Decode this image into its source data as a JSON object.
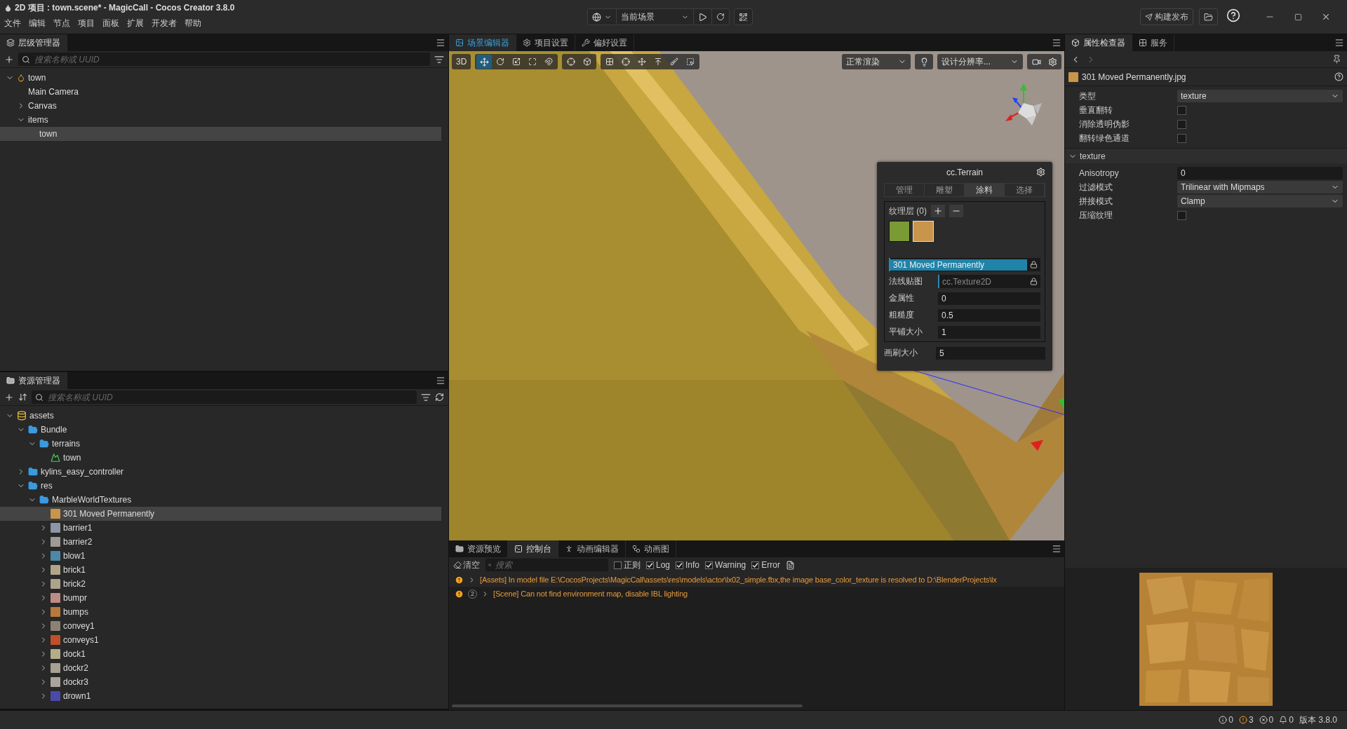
{
  "window": {
    "title": "2D 项目 : town.scene* - MagicCall - Cocos Creator 3.8.0"
  },
  "menu": [
    "文件",
    "编辑",
    "节点",
    "项目",
    "面板",
    "扩展",
    "开发者",
    "帮助"
  ],
  "toolbar": {
    "preview_target": "当前场景",
    "build_button": "构建发布"
  },
  "hierarchy": {
    "tab": "层级管理器",
    "search": {
      "placeholder": "搜索名称或 UUID"
    },
    "tree": [
      {
        "label": "town",
        "kind": "scene",
        "expanded": true,
        "selected": false,
        "children": [
          {
            "label": "Main Camera",
            "selected": false
          },
          {
            "label": "Canvas",
            "expanded": false,
            "selected": false
          },
          {
            "label": "items",
            "expanded": true,
            "selected": false,
            "children": [
              {
                "label": "town",
                "selected": true
              }
            ]
          }
        ]
      }
    ]
  },
  "assets": {
    "tab": "资源管理器",
    "search": {
      "placeholder": "搜索名称或 UUID"
    },
    "tree": [
      {
        "label": "assets",
        "kind": "database",
        "expanded": true,
        "selected": false,
        "children": [
          {
            "label": "Bundle",
            "kind": "folder",
            "expanded": true,
            "selected": false,
            "children": [
              {
                "label": "terrains",
                "kind": "folder",
                "expanded": true,
                "selected": false,
                "children": [
                  {
                    "label": "town",
                    "kind": "terrain",
                    "selected": false
                  }
                ]
              }
            ]
          },
          {
            "label": "kylins_easy_controller",
            "kind": "folder",
            "expanded": false,
            "selected": false
          },
          {
            "label": "res",
            "kind": "folder",
            "expanded": true,
            "selected": false,
            "children": [
              {
                "label": "MarbleWorldTextures",
                "kind": "folder",
                "expanded": true,
                "selected": false,
                "children": [
                  {
                    "label": "301 Moved Permanently",
                    "kind": "texture",
                    "color": "#c8954a",
                    "selected": true
                  },
                  {
                    "label": "barrier1",
                    "kind": "texture",
                    "color": "#8c96a4",
                    "expanded": false,
                    "selected": false
                  },
                  {
                    "label": "barrier2",
                    "kind": "texture",
                    "color": "#a09a94",
                    "expanded": false,
                    "selected": false
                  },
                  {
                    "label": "blow1",
                    "kind": "texture",
                    "color": "#4a8aa8",
                    "expanded": false,
                    "selected": false
                  },
                  {
                    "label": "brick1",
                    "kind": "texture",
                    "color": "#b0a48a",
                    "expanded": false,
                    "selected": false
                  },
                  {
                    "label": "brick2",
                    "kind": "texture",
                    "color": "#ada38c",
                    "expanded": false,
                    "selected": false
                  },
                  {
                    "label": "bumpr",
                    "kind": "texture",
                    "color": "#c08a86",
                    "expanded": false,
                    "selected": false
                  },
                  {
                    "label": "bumps",
                    "kind": "texture",
                    "color": "#b87a3a",
                    "expanded": false,
                    "selected": false
                  },
                  {
                    "label": "convey1",
                    "kind": "texture",
                    "color": "#8c8274",
                    "expanded": false,
                    "selected": false
                  },
                  {
                    "label": "conveys1",
                    "kind": "texture",
                    "color": "#c0502a",
                    "expanded": false,
                    "selected": false
                  },
                  {
                    "label": "dock1",
                    "kind": "texture",
                    "color": "#b4ad8a",
                    "expanded": false,
                    "selected": false
                  },
                  {
                    "label": "dockr2",
                    "kind": "texture",
                    "color": "#a8a092",
                    "expanded": false,
                    "selected": false
                  },
                  {
                    "label": "dockr3",
                    "kind": "texture",
                    "color": "#aaa49c",
                    "expanded": false,
                    "selected": false
                  },
                  {
                    "label": "drown1",
                    "kind": "texture",
                    "color": "#4a4aa8",
                    "expanded": false,
                    "selected": false
                  }
                ]
              }
            ]
          }
        ]
      }
    ]
  },
  "scene": {
    "tabs": [
      {
        "label": "场景编辑器",
        "kind": "scene",
        "selected": true
      },
      {
        "label": "项目设置",
        "kind": "settings",
        "selected": false
      },
      {
        "label": "偏好设置",
        "kind": "tools",
        "selected": false
      }
    ],
    "mode_button": "3D",
    "render_mode": "正常渲染",
    "resolution": "设计分辨率...",
    "terrain_panel": {
      "title": "cc.Terrain",
      "tabs": [
        {
          "label": "管理",
          "selected": false
        },
        {
          "label": "雕塑",
          "selected": false
        },
        {
          "label": "涂料",
          "selected": true
        },
        {
          "label": "选择",
          "selected": false
        }
      ],
      "layers_label": "纹理层 (0)",
      "layers": [
        {
          "color": "#7a9a34",
          "selected": false
        },
        {
          "color": "#c8954a",
          "selected": true
        }
      ],
      "texture": "301 Moved Permanently",
      "props": [
        {
          "label": "法线贴图",
          "kind": "asset",
          "value": "cc.Texture2D"
        },
        {
          "label": "金属性",
          "kind": "number",
          "value": "0"
        },
        {
          "label": "粗糙度",
          "kind": "number",
          "value": "0.5"
        },
        {
          "label": "平铺大小",
          "kind": "number",
          "value": "1"
        }
      ],
      "brush": [
        {
          "label": "画刷大小",
          "value": "5"
        }
      ]
    }
  },
  "console": {
    "tabs": [
      {
        "label": "资源预览",
        "kind": "folder",
        "selected": false
      },
      {
        "label": "控制台",
        "kind": "terminal",
        "selected": true
      },
      {
        "label": "动画编辑器",
        "kind": "run",
        "selected": false
      },
      {
        "label": "动画图",
        "kind": "graph",
        "selected": false
      }
    ],
    "clear_button": "清空",
    "search": {
      "placeholder": "搜索"
    },
    "filters": [
      {
        "label": "正则",
        "checked": false
      },
      {
        "label": "Log",
        "checked": true
      },
      {
        "label": "Info",
        "checked": true
      },
      {
        "label": "Warning",
        "checked": true
      },
      {
        "label": "Error",
        "checked": true
      }
    ],
    "messages": [
      {
        "kind": "warning",
        "text": "[Assets] In model file E:\\CocosProjects\\MagicCall\\assets\\res\\models\\actor\\lx02_simple.fbx,the image base_color_texture is resolved to D:\\BlenderProjects\\lx"
      },
      {
        "kind": "warning",
        "count": "2",
        "text": "[Scene] Can not find environment map, disable IBL lighting"
      }
    ]
  },
  "inspector": {
    "tabs": [
      {
        "label": "属性检查器",
        "selected": true
      },
      {
        "label": "服务",
        "selected": false
      }
    ],
    "asset_name": "301 Moved Permanently.jpg",
    "props": [
      {
        "label": "类型",
        "kind": "select",
        "value": "texture"
      },
      {
        "label": "垂直翻转",
        "kind": "checkbox",
        "checked": false
      },
      {
        "label": "消除透明伪影",
        "kind": "checkbox",
        "checked": false
      },
      {
        "label": "翻转绿色通道",
        "kind": "checkbox",
        "checked": false
      }
    ],
    "section": {
      "title": "texture",
      "expanded": true,
      "props": [
        {
          "label": "Anisotropy",
          "kind": "number",
          "value": "0"
        },
        {
          "label": "过滤模式",
          "kind": "select",
          "value": "Trilinear with Mipmaps"
        },
        {
          "label": "拼接模式",
          "kind": "select",
          "value": "Clamp"
        },
        {
          "label": "压缩纹理",
          "kind": "checkbox",
          "checked": false
        }
      ]
    }
  },
  "status_bar": {
    "counts": [
      {
        "kind": "info",
        "count": "0"
      },
      {
        "kind": "warning",
        "count": "3"
      },
      {
        "kind": "error",
        "count": "0"
      },
      {
        "kind": "notice",
        "count": "0"
      }
    ],
    "version": "版本 3.8.0"
  }
}
